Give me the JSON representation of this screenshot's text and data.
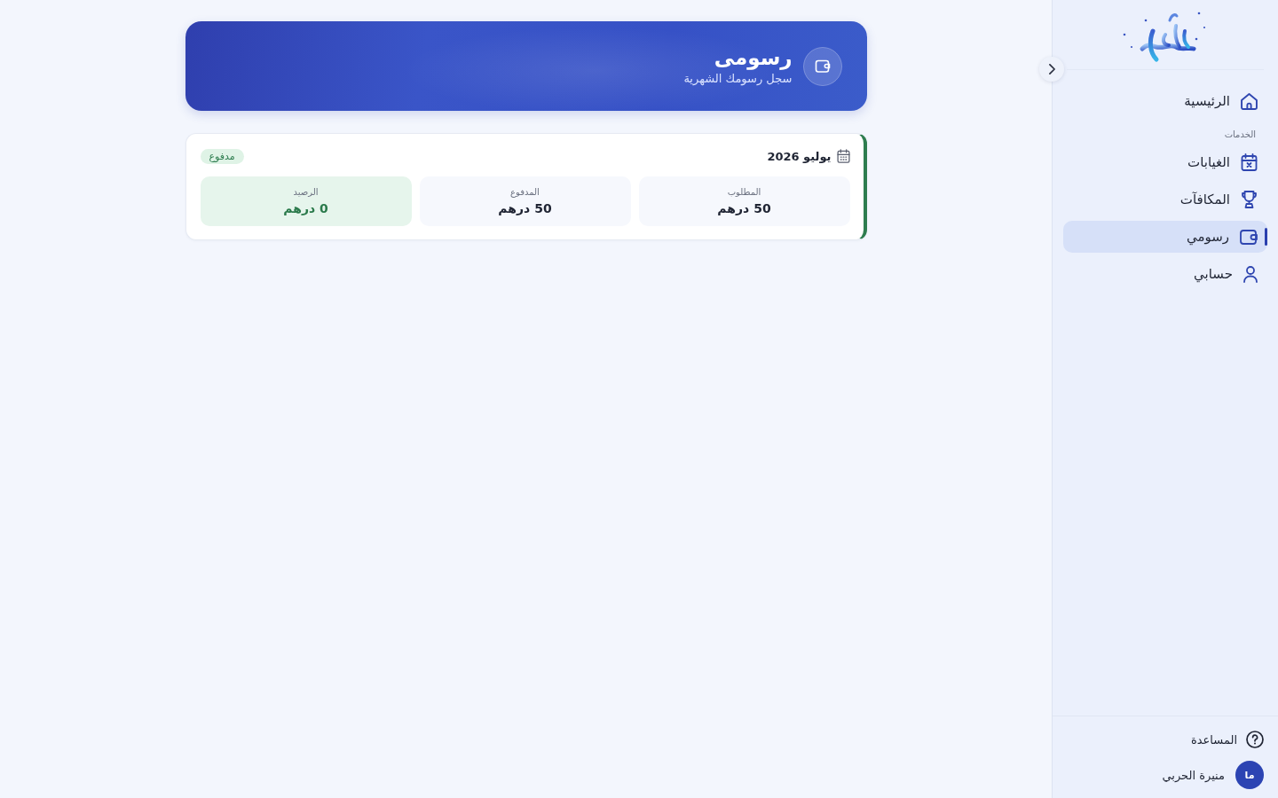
{
  "sidebar": {
    "nav": [
      {
        "label": "الرئيسية",
        "selected": false
      }
    ],
    "services": {
      "heading": "الخدمات",
      "items": [
        {
          "label": "الغيابات",
          "selected": false
        },
        {
          "label": "المكافآت",
          "selected": false
        },
        {
          "label": "رسومي",
          "selected": true
        },
        {
          "label": "حسابي",
          "selected": false
        }
      ]
    },
    "help": {
      "label": "المساعدة"
    },
    "user": {
      "initials": "ما",
      "name": "منيرة الحربي"
    }
  },
  "page_header": {
    "title": "رسومى",
    "subtitle": "سجل رسومك الشهرية"
  },
  "fees": [
    {
      "month": "يوليو 2026",
      "status": "مدفوع",
      "kind": "paid",
      "stats": [
        {
          "label": "المطلوب",
          "value": "50 درهم",
          "kind": "neutral"
        },
        {
          "label": "المدفوع",
          "value": "50 درهم",
          "kind": "neutral"
        },
        {
          "label": "الرصيد",
          "value": "0 درهم",
          "kind": "positive"
        }
      ]
    }
  ]
}
